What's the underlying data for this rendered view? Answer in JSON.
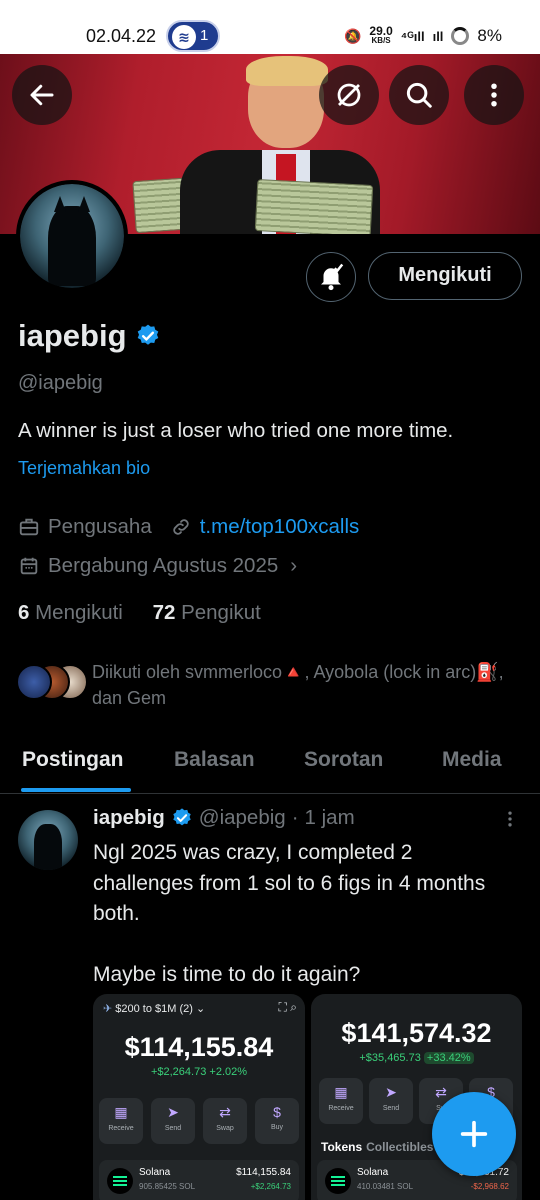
{
  "status_bar": {
    "time": "02.04.22",
    "notif_count": "1",
    "speed_value": "29.0",
    "speed_unit": "KB/S",
    "network": "4G",
    "battery": "8%"
  },
  "header": {
    "back_icon": "arrow-left-icon",
    "icons": [
      "hide-icon",
      "search-icon",
      "more-vertical-icon"
    ]
  },
  "profile": {
    "follow_button": "Mengikuti",
    "name": "iapebig",
    "handle": "@iapebig",
    "bio": "A winner is just a loser who tried one more time.",
    "translate_bio": "Terjemahkan bio",
    "category": "Pengusaha",
    "link": "t.me/top100xcalls",
    "joined": "Bergabung Agustus 2025",
    "following_count": "6",
    "following_label": "Mengikuti",
    "followers_count": "72",
    "followers_label": "Pengikut",
    "followed_by": "Diikuti oleh svmmerloco🔺, Ayobola (lock in arc)⛽, dan Gem"
  },
  "tabs": [
    "Postingan",
    "Balasan",
    "Sorotan",
    "Media"
  ],
  "post": {
    "name": "iapebig",
    "handle": "@iapebig",
    "separator": "·",
    "time": "1 jam",
    "text_line1": "Ngl 2025 was crazy, I completed 2 challenges from 1 sol to 6 figs in 4 months both.",
    "text_line2": "Maybe is time to do it again?",
    "image1": {
      "wallet_name": "$200 to $1M (2)",
      "balance": "$114,155.84",
      "change": "+$2,264.73",
      "change_pct": "+2.02%",
      "actions": [
        "Receive",
        "Send",
        "Swap",
        "Buy"
      ],
      "token_name": "Solana",
      "token_amount": "905.85425 SOL",
      "token_value": "$114,155.84",
      "token_change": "+$2,264.73"
    },
    "image2": {
      "balance": "$141,574.32",
      "change": "+$35,465.73",
      "change_pct": "+33.42%",
      "actions": [
        "Receive",
        "Send",
        "Sw"
      ],
      "tokens_label": "Tokens",
      "collectibles_label": "Collectibles",
      "token_name": "Solana",
      "token_amount": "410.03481 SOL",
      "token_value": "$8?,?31.72",
      "token_change": "-$2,968.62"
    }
  },
  "colors": {
    "accent": "#1d9bf0",
    "background": "#000000",
    "muted_text": "#71767b",
    "text": "#e7e9ea"
  }
}
